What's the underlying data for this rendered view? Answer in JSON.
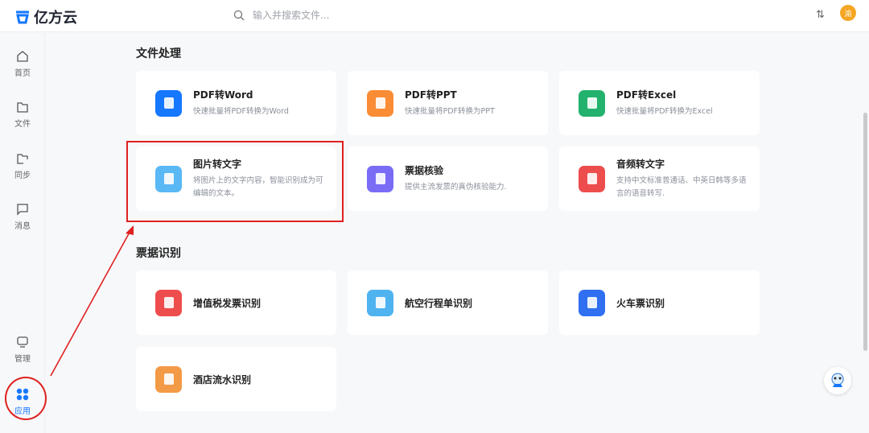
{
  "header": {
    "logo": "亿方云",
    "search_placeholder": "输入并搜索文件...",
    "avatar": "渝"
  },
  "sidebar": [
    {
      "label": "首页"
    },
    {
      "label": "文件"
    },
    {
      "label": "同步"
    },
    {
      "label": "消息"
    },
    {
      "label": "管理"
    },
    {
      "label": "应用"
    }
  ],
  "sections": [
    {
      "title": "文件处理",
      "cards": [
        {
          "title": "PDF转Word",
          "desc": "快速批量将PDF转换为Word",
          "color": "#1677ff"
        },
        {
          "title": "PDF转PPT",
          "desc": "快速批量将PDF转换为PPT",
          "color": "#fa8c35"
        },
        {
          "title": "PDF转Excel",
          "desc": "快速批量将PDF转换为Excel",
          "color": "#23b26d"
        },
        {
          "title": "图片转文字",
          "desc": "将图片上的文字内容，智能识别成为可编辑的文本。",
          "color": "#5ab8f5"
        },
        {
          "title": "票据核验",
          "desc": "提供主流发票的真伪核验能力.",
          "color": "#7b6cf6"
        },
        {
          "title": "音频转文字",
          "desc": "支持中文标准普通话、中英日韩等多语言的语音转写.",
          "color": "#ee4d4d"
        }
      ]
    },
    {
      "title": "票据识别",
      "cards": [
        {
          "title": "增值税发票识别",
          "desc": "",
          "color": "#ee4d4d"
        },
        {
          "title": "航空行程单识别",
          "desc": "",
          "color": "#4fb3f0"
        },
        {
          "title": "火车票识别",
          "desc": "",
          "color": "#2f6ff0"
        },
        {
          "title": "酒店流水识别",
          "desc": "",
          "color": "#f39a47"
        }
      ]
    }
  ]
}
